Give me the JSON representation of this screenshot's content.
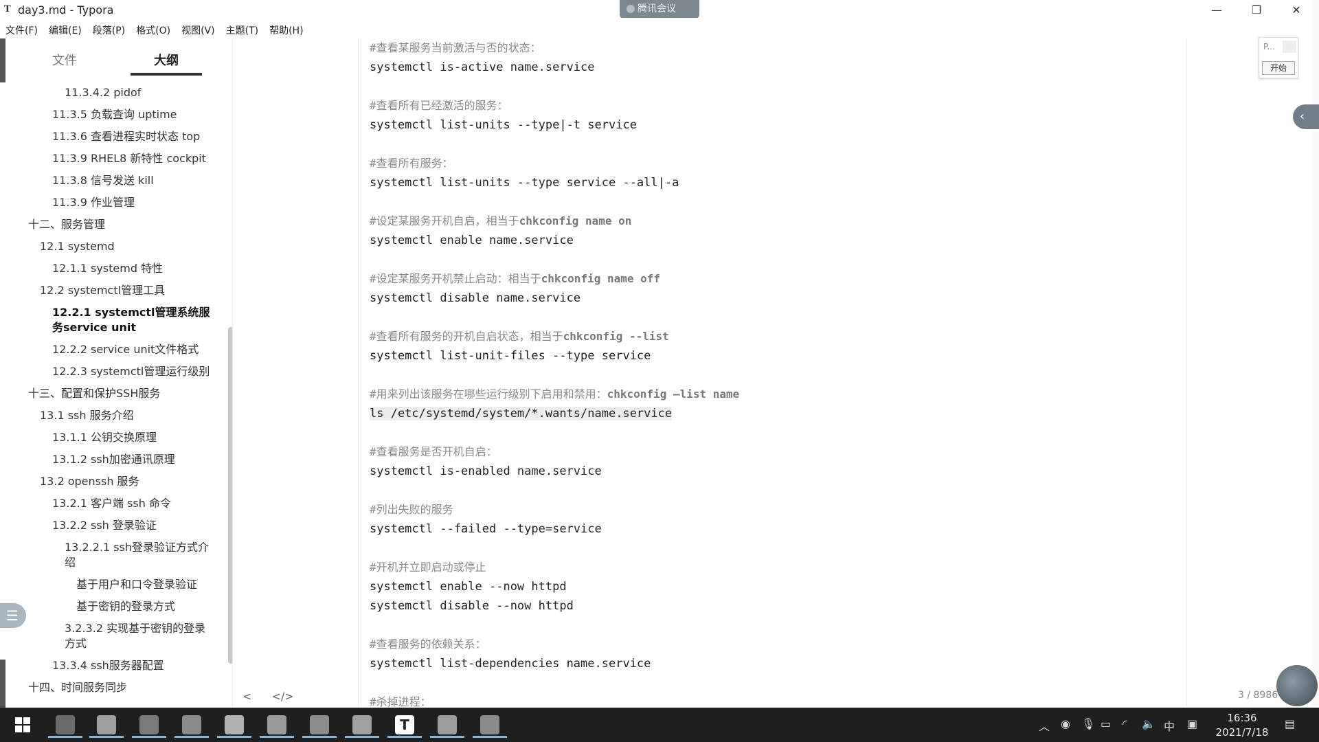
{
  "window": {
    "title": "day3.md - Typora",
    "app_icon": "T",
    "meeting_label": "腾讯会议",
    "minimize": "—",
    "restore": "❐",
    "close": "✕"
  },
  "menu": [
    "文件(F)",
    "编辑(E)",
    "段落(P)",
    "格式(O)",
    "视图(V)",
    "主题(T)",
    "帮助(H)"
  ],
  "sidebar": {
    "tab_file": "文件",
    "tab_outline": "大纲",
    "outline": [
      {
        "label": "11.3.4.2 pidof",
        "level": 4
      },
      {
        "label": "11.3.5 负载查询 uptime",
        "level": 3
      },
      {
        "label": "11.3.6 查看进程实时状态 top",
        "level": 3
      },
      {
        "label": "11.3.9 RHEL8 新特性 cockpit",
        "level": 3
      },
      {
        "label": "11.3.8 信号发送 kill",
        "level": 3
      },
      {
        "label": "11.3.9 作业管理",
        "level": 3
      },
      {
        "label": "十二、服务管理",
        "level": 1
      },
      {
        "label": "12.1 systemd",
        "level": 2
      },
      {
        "label": "12.1.1 systemd 特性",
        "level": 3
      },
      {
        "label": "12.2 systemctl管理工具",
        "level": 2
      },
      {
        "label": "12.2.1 systemctl管理系统服务service unit",
        "level": 3,
        "active": true
      },
      {
        "label": "12.2.2 service unit文件格式",
        "level": 3
      },
      {
        "label": "12.2.3 systemctl管理运行级别",
        "level": 3
      },
      {
        "label": "十三、配置和保护SSH服务",
        "level": 1
      },
      {
        "label": "13.1 ssh 服务介绍",
        "level": 2
      },
      {
        "label": "13.1.1 公钥交换原理",
        "level": 3
      },
      {
        "label": "13.1.2 ssh加密通讯原理",
        "level": 3
      },
      {
        "label": "13.2 openssh 服务",
        "level": 2
      },
      {
        "label": "13.2.1 客户端 ssh 命令",
        "level": 3
      },
      {
        "label": "13.2.2 ssh 登录验证",
        "level": 3
      },
      {
        "label": "13.2.2.1 ssh登录验证方式介绍",
        "level": 4
      },
      {
        "label": "基于用户和口令登录验证",
        "level": 5
      },
      {
        "label": "基于密钥的登录方式",
        "level": 5
      },
      {
        "label": "3.2.3.2 实现基于密钥的登录方式",
        "level": 4
      },
      {
        "label": "13.3.4 ssh服务器配置",
        "level": 3
      },
      {
        "label": "十四、时间服务同步",
        "level": 1
      }
    ]
  },
  "editor": {
    "blocks": [
      {
        "comment": "#查看某服务当前激活与否的状态：",
        "code": [
          "systemctl is-active name.service"
        ]
      },
      {
        "comment": "#查看所有已经激活的服务：",
        "code": [
          "systemctl list-units --type|-t service"
        ]
      },
      {
        "comment": "#查看所有服务：",
        "code": [
          "systemctl list-units --type service --all|-a"
        ]
      },
      {
        "comment": "#设定某服务开机自启，相当于",
        "comment_bold": "chkconfig name on",
        "code": [
          "systemctl enable name.service"
        ]
      },
      {
        "comment": "#设定某服务开机禁止启动：相当于",
        "comment_bold": "chkconfig name off",
        "code": [
          "systemctl disable name.service"
        ]
      },
      {
        "comment": "#查看所有服务的开机自启状态，相当于",
        "comment_bold": "chkconfig --list",
        "code": [
          "systemctl list-unit-files --type service"
        ]
      },
      {
        "comment": "#用来列出该服务在哪些运行级别下启用和禁用：",
        "comment_bold": "chkconfig –list name",
        "code": [
          "ls /etc/systemd/system/*.wants/name.service"
        ],
        "highlight": true
      },
      {
        "comment": "#查看服务是否开机自启：",
        "code": [
          "systemctl is-enabled name.service"
        ]
      },
      {
        "comment": "#列出失败的服务",
        "code": [
          "systemctl --failed --type=service"
        ]
      },
      {
        "comment": "#开机并立即启动或停止",
        "code": [
          "systemctl enable --now httpd",
          "systemctl disable --now httpd"
        ]
      },
      {
        "comment": "#查看服务的依赖关系：",
        "code": [
          "systemctl list-dependencies name.service"
        ]
      },
      {
        "comment": "#杀掉进程：",
        "code": []
      }
    ],
    "bottom_left_arrow": "<",
    "bottom_source_toggle": "</>",
    "word_count": "3 / 8986"
  },
  "mini_panel": {
    "p_label": "P...",
    "start_label": "开始"
  },
  "right_collapse_icon": "‹",
  "outline_toggle_icon": "☰",
  "taskbar": {
    "time": "16:36",
    "date": "2021/7/18",
    "ime": "中",
    "colors": [
      "#6b6b6b",
      "#9e9e9e",
      "#7a7a7a",
      "#8a8a8a",
      "#b0b0b0",
      "#9a9a9a",
      "#8c8c8c",
      "#a0a0a0",
      "#ffffff",
      "#9c9c9c",
      "#8a8a8a"
    ]
  }
}
